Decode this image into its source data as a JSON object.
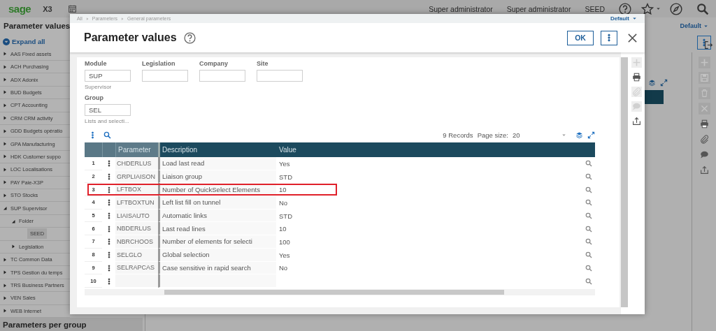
{
  "topbar": {
    "logo": "sage",
    "product": "X3",
    "user_items": [
      "Super administrator",
      "Super administrator",
      "SEED"
    ]
  },
  "sidebar": {
    "title": "Parameter values",
    "expand_all": "Expand all",
    "items": [
      {
        "label": "AAS Fixed assets",
        "expanded": false,
        "selected": false
      },
      {
        "label": "ACH Purchasing",
        "expanded": false,
        "selected": false
      },
      {
        "label": "ADX Adonix",
        "expanded": false,
        "selected": false
      },
      {
        "label": "BUD Budgets",
        "expanded": false,
        "selected": false
      },
      {
        "label": "CPT Accounting",
        "expanded": false,
        "selected": false
      },
      {
        "label": "CRM CRM activity",
        "expanded": false,
        "selected": false
      },
      {
        "label": "GDD Budgets opératio",
        "expanded": false,
        "selected": false
      },
      {
        "label": "GPA Manufacturing",
        "expanded": false,
        "selected": false
      },
      {
        "label": "HDK Customer suppo",
        "expanded": false,
        "selected": false
      },
      {
        "label": "LOC Localisations",
        "expanded": false,
        "selected": false
      },
      {
        "label": "PAY Paie-X3P",
        "expanded": false,
        "selected": false
      },
      {
        "label": "STO Stocks",
        "expanded": false,
        "selected": false
      },
      {
        "label": "SUP Supervisor",
        "expanded": true,
        "selected": false,
        "children": [
          {
            "label": "Folder",
            "expanded": true,
            "selected": false,
            "children": [
              {
                "label": "SEED",
                "selected": true
              }
            ]
          },
          {
            "label": "Legislation",
            "expanded": false,
            "selected": false
          }
        ]
      },
      {
        "label": "TC Common Data",
        "expanded": false,
        "selected": false
      },
      {
        "label": "TPS Gestion du temps",
        "expanded": false,
        "selected": false
      },
      {
        "label": "TRS Business Partners",
        "expanded": false,
        "selected": false
      },
      {
        "label": "VEN Sales",
        "expanded": false,
        "selected": false
      },
      {
        "label": "WEB Internet",
        "expanded": false,
        "selected": false
      }
    ],
    "footer": "Parameters per group"
  },
  "background": {
    "view": "Default",
    "tools": [
      {
        "kind": "add",
        "disabled": true
      },
      {
        "kind": "save",
        "disabled": true
      },
      {
        "kind": "delete",
        "disabled": true
      },
      {
        "kind": "cancel",
        "disabled": true
      },
      {
        "kind": "print",
        "disabled": false
      },
      {
        "kind": "attach",
        "disabled": false
      },
      {
        "kind": "comment",
        "disabled": false
      },
      {
        "kind": "export",
        "disabled": false
      }
    ]
  },
  "dialog": {
    "breadcrumb": [
      "All",
      "Parameters",
      "General parameters"
    ],
    "view": "Default",
    "title": "Parameter values",
    "ok_button": "OK",
    "field_rows": [
      [
        {
          "label": "Module",
          "value": "SUP",
          "hint": "Supervisor"
        },
        {
          "label": "Legislation"
        },
        {
          "label": "Company"
        },
        {
          "label": "Site"
        }
      ],
      [
        {
          "label": "Group",
          "value": "SEL",
          "hint": "Lists and selecti..."
        }
      ]
    ],
    "grid": {
      "records": "9 Records",
      "page_size_label": "Page size:",
      "page_size": "20",
      "columns": [
        "Parameter",
        "Description",
        "Value"
      ],
      "rows": [
        {
          "number": "1",
          "parameter": "CHDERLUS",
          "description": "Load last read",
          "value": "Yes",
          "highlighted": false
        },
        {
          "number": "2",
          "parameter": "GRPLIAISON",
          "description": "Liaison group",
          "value": "STD",
          "highlighted": false
        },
        {
          "number": "3",
          "parameter": "LFTBOX",
          "description": "Number of QuickSelect Elements",
          "value": "10",
          "highlighted": true
        },
        {
          "number": "4",
          "parameter": "LFTBOXTUN",
          "description": "Left list fill on tunnel",
          "value": "No",
          "highlighted": false
        },
        {
          "number": "5",
          "parameter": "LIAISAUTO",
          "description": "Automatic links",
          "value": "STD",
          "highlighted": false
        },
        {
          "number": "6",
          "parameter": "NBDERLUS",
          "description": "Last read lines",
          "value": "10",
          "highlighted": false
        },
        {
          "number": "7",
          "parameter": "NBRCHOOS",
          "description": "Number of elements for selecti",
          "value": "100",
          "highlighted": false
        },
        {
          "number": "8",
          "parameter": "SELGLO",
          "description": "Global selection",
          "value": "Yes",
          "highlighted": false
        },
        {
          "number": "9",
          "parameter": "SELRAPCAS",
          "description": "Case sensitive in rapid search",
          "value": "No",
          "highlighted": false
        },
        {
          "number": "10",
          "highlighted": false
        }
      ]
    },
    "tools": [
      {
        "kind": "add",
        "disabled": true
      },
      {
        "kind": "print",
        "disabled": false
      },
      {
        "kind": "attach",
        "disabled": true
      },
      {
        "kind": "comment",
        "disabled": true
      },
      {
        "kind": "export",
        "disabled": false
      }
    ]
  }
}
